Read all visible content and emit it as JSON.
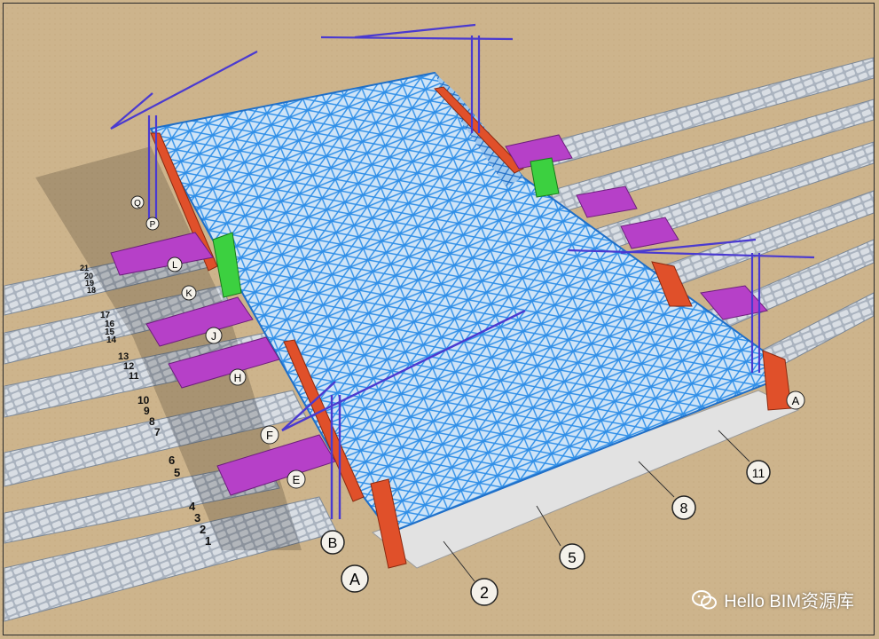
{
  "grid": {
    "columns": [
      "A",
      "B",
      "E",
      "F",
      "H",
      "J",
      "K",
      "L",
      "P",
      "Q"
    ],
    "axes": [
      "2",
      "5",
      "8",
      "11"
    ],
    "far_corner": "A"
  },
  "tracks": {
    "group_1": [
      "4",
      "3",
      "2",
      "1"
    ],
    "group_2": [
      "6",
      "5"
    ],
    "group_3": [
      "10",
      "9",
      "8",
      "7"
    ],
    "group_4": [
      "13",
      "12",
      "11"
    ],
    "group_5": [
      "17",
      "16",
      "15",
      "14"
    ],
    "group_6": [
      "21",
      "20",
      "19",
      "18"
    ]
  },
  "watermark": {
    "text": "Hello BIM资源库",
    "icon": "wechat-icon"
  },
  "colors": {
    "ground": "#cdb48c",
    "roof_truss": "#2f8fe8",
    "canopy": "#b640c8",
    "crane": "#4a3ad0",
    "support_frame": "#e0502a",
    "slab": "#e0e0e0",
    "track": "#9aa4b0"
  }
}
